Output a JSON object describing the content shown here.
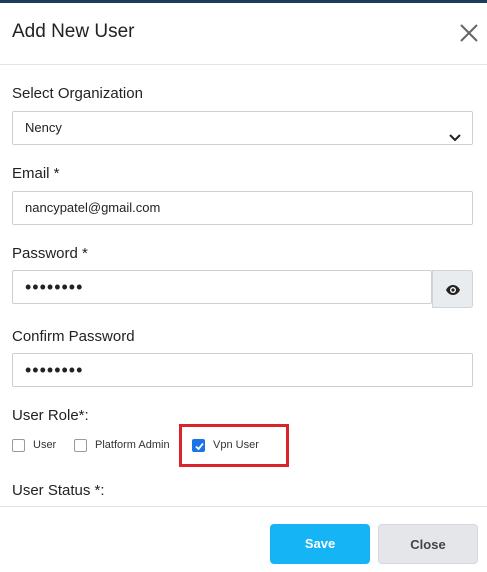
{
  "modal": {
    "title": "Add New User",
    "close_icon": "close-x-icon"
  },
  "organization": {
    "label": "Select Organization",
    "value": "Nency",
    "icon": "chevron-down-icon"
  },
  "email": {
    "label": "Email *",
    "value": "nancypatel@gmail.com"
  },
  "password": {
    "label": "Password *",
    "masked": "••••••••",
    "toggle_icon": "eye-icon"
  },
  "confirm_password": {
    "label": "Confirm Password",
    "masked": "••••••••"
  },
  "user_role": {
    "label": "User Role*:",
    "options": [
      {
        "label": "User",
        "checked": false
      },
      {
        "label": "Platform Admin",
        "checked": false
      },
      {
        "label": "Vpn User",
        "checked": true
      }
    ],
    "highlight_color": "#d9252a"
  },
  "user_status": {
    "label": "User Status *:"
  },
  "footer": {
    "save_label": "Save",
    "close_label": "Close",
    "save_color": "#14b4f5"
  }
}
